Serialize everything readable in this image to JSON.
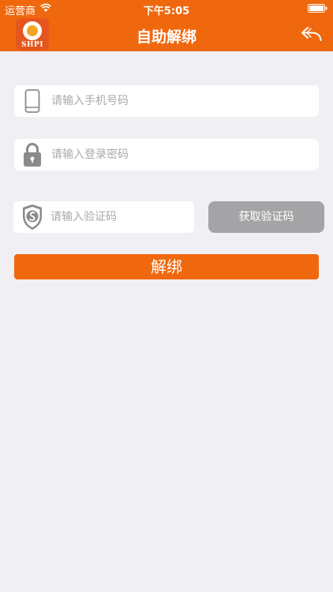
{
  "status_bar": {
    "carrier": "运营商",
    "time": "下午5:05"
  },
  "nav": {
    "title": "自助解绑",
    "logo_text": "SHPI",
    "back_icon": "back-arrow-icon"
  },
  "form": {
    "phone": {
      "placeholder": "请输入手机号码",
      "value": "",
      "icon": "phone-icon"
    },
    "password": {
      "placeholder": "请输入登录密码",
      "value": "",
      "icon": "lock-icon"
    },
    "code": {
      "placeholder": "请输入验证码",
      "value": "",
      "icon": "shield-icon"
    },
    "get_code_label": "获取验证码",
    "submit_label": "解绑"
  },
  "colors": {
    "brand": "#f0680e",
    "background": "#efeff4",
    "disabled_button": "#a4a4a6",
    "placeholder": "#a9a9a9"
  }
}
